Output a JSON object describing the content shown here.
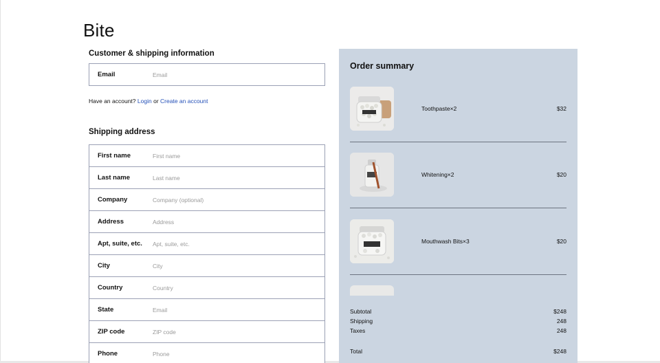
{
  "brand": "Bite",
  "customer": {
    "title": "Customer & shipping information",
    "email_label": "Email",
    "email_placeholder": "Email"
  },
  "account": {
    "prefix": "Have an account?",
    "login": "Login",
    "or": "or",
    "create": "Create an account"
  },
  "shipping": {
    "title": "Shipping address",
    "fields": [
      {
        "label": "First name",
        "placeholder": "First name"
      },
      {
        "label": "Last name",
        "placeholder": "Last name"
      },
      {
        "label": "Company",
        "placeholder": "Company (optional)"
      },
      {
        "label": "Address",
        "placeholder": "Address"
      },
      {
        "label": "Apt, suite, etc.",
        "placeholder": "Apt, suite, etc."
      },
      {
        "label": "City",
        "placeholder": "City"
      },
      {
        "label": "Country",
        "placeholder": "Country"
      },
      {
        "label": "State",
        "placeholder": "Email"
      },
      {
        "label": "ZIP code",
        "placeholder": "ZIP code"
      },
      {
        "label": "Phone",
        "placeholder": "Phone"
      }
    ]
  },
  "summary": {
    "title": "Order summary",
    "items": [
      {
        "name": "Toothpaste×2",
        "price": "$32",
        "icon": "toothpaste-jar-image"
      },
      {
        "name": "Whitening×2",
        "price": "$20",
        "icon": "whitening-bottle-image"
      },
      {
        "name": "Mouthwash Bits×3",
        "price": "$20",
        "icon": "mouthwash-jar-image"
      },
      {
        "name": "",
        "price": "",
        "icon": "product-image"
      }
    ],
    "subtotal_label": "Subtotal",
    "subtotal_value": "$248",
    "shipping_label": "Shipping",
    "shipping_value": "248",
    "taxes_label": "Taxes",
    "taxes_value": "248",
    "total_label": "Total",
    "total_value": "$248",
    "background": "#cbd5e1"
  },
  "colors": {
    "link": "#2450b8",
    "field_border": "#9aa0b4"
  }
}
